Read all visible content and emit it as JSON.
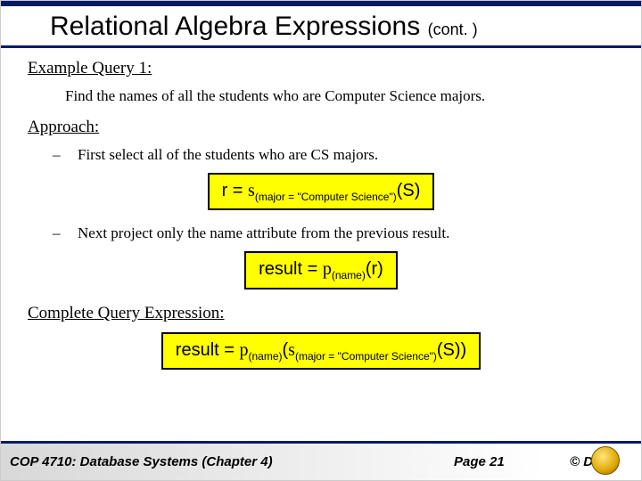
{
  "title_main": "Relational Algebra Expressions ",
  "title_cont": "(cont. )",
  "section_example": "Example Query 1:",
  "prompt_text": "Find the names of all the students who are Computer Science majors.",
  "section_approach": "Approach:",
  "dash": "–",
  "step1_text": "First select all of the students who are CS majors.",
  "step2_text": "Next project only the name attribute from the previous result.",
  "section_complete": "Complete Query Expression:",
  "formula1": {
    "lhs": "r = ",
    "sigma": "s",
    "sub": "(major = \"Computer Science\")",
    "arg": "(S)"
  },
  "formula2": {
    "lhs": "result = ",
    "pi": "p",
    "sub": "(name)",
    "arg": "(r)"
  },
  "formula3": {
    "lhs": "result = ",
    "pi": "p",
    "sub1": "(name)",
    "mid": "(",
    "sigma": "s",
    "sub2": "(major = \"Computer Science\")",
    "arg": "(S))"
  },
  "footer": {
    "left": "COP 4710: Database Systems  (Chapter 4)",
    "center": "Page 21",
    "right": "© Dr."
  }
}
